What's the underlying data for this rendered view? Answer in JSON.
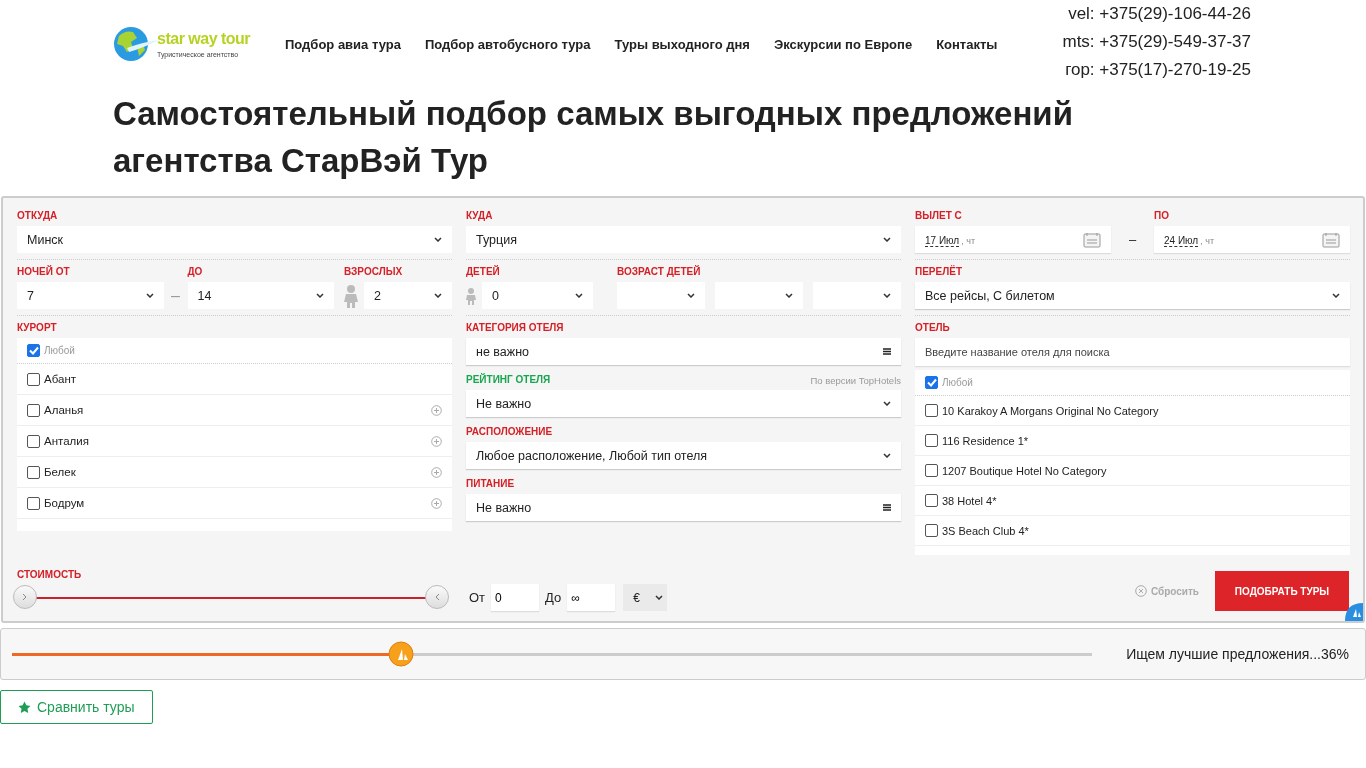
{
  "header": {
    "logo": {
      "name": "star way tour",
      "tagline": "Туристическое агентство"
    },
    "nav": [
      "Подбор авиа тура",
      "Подбор автобусного тура",
      "Туры выходного дня",
      "Экскурсии по Европе",
      "Контакты"
    ],
    "phones": [
      "vel: +375(29)-106-44-26",
      "mts: +375(29)-549-37-37",
      "гор: +375(17)-270-19-25"
    ]
  },
  "heading": "Самостоятельный подбор самых выгодных предложений агентства СтарВэй Тур",
  "search": {
    "from": {
      "label": "ОТКУДА",
      "value": "Минск"
    },
    "to": {
      "label": "КУДА",
      "value": "Турция"
    },
    "departure": {
      "label": "ВЫЛЕТ С",
      "date": "17 Июл",
      "weekday": ", чт"
    },
    "until": {
      "label": "ПО",
      "date": "24 Июл",
      "weekday": ", чт"
    },
    "date_separator": "–",
    "nights_separator": "–",
    "nights_from": {
      "label": "НОЧЕЙ ОТ",
      "value": "7"
    },
    "nights_to": {
      "label": "ДО",
      "value": "14"
    },
    "adults": {
      "label": "ВЗРОСЛЫХ",
      "value": "2"
    },
    "children": {
      "label": "ДЕТЕЙ",
      "value": "0"
    },
    "children_age": {
      "label": "ВОЗРАСТ ДЕТЕЙ",
      "selects": [
        {
          "kind": "select"
        },
        {
          "kind": "select"
        },
        {
          "kind": "select"
        }
      ]
    },
    "flight": {
      "label": "ПЕРЕЛЁТ",
      "value": "Все рейсы, С билетом"
    },
    "resort": {
      "label": "КУРОРТ",
      "items": [
        {
          "label": "Любой",
          "checked": true,
          "expandable": false
        },
        {
          "label": "Абант",
          "checked": false,
          "expandable": false
        },
        {
          "label": "Аланья",
          "checked": false,
          "expandable": true
        },
        {
          "label": "Анталия",
          "checked": false,
          "expandable": true
        },
        {
          "label": "Белек",
          "checked": false,
          "expandable": true
        },
        {
          "label": "Бодрум",
          "checked": false,
          "expandable": true
        }
      ]
    },
    "hotel_category": {
      "label": "КАТЕГОРИЯ ОТЕЛЯ",
      "value": "не важно",
      "kind": "multi"
    },
    "hotel_rating": {
      "label": "РЕЙТИНГ ОТЕЛЯ",
      "note": "По версии TopHotels",
      "value": "Не важно",
      "kind": "select",
      "highlighted": true
    },
    "location": {
      "label": "РАСПОЛОЖЕНИЕ",
      "value": "Любое расположение, Любой тип отеля",
      "kind": "select"
    },
    "meals": {
      "label": "ПИТАНИЕ",
      "value": "Не важно",
      "kind": "multi"
    },
    "hotel": {
      "label": "ОТЕЛЬ",
      "placeholder": "Введите название отеля для поиска",
      "items": [
        {
          "label": "Любой",
          "checked": true
        },
        {
          "label": "10 Karakoy A Morgans Original No Category",
          "checked": false
        },
        {
          "label": "116 Residence 1*",
          "checked": false
        },
        {
          "label": "1207 Boutique Hotel No Category",
          "checked": false
        },
        {
          "label": "38 Hotel 4*",
          "checked": false
        },
        {
          "label": "3S Beach Club 4*",
          "checked": false
        }
      ]
    },
    "price": {
      "label": "СТОИМОСТЬ",
      "thumbs": [
        {
          "level": 0
        },
        {
          "level": 1
        }
      ],
      "from_label": "От",
      "from": "0",
      "to_label": "До",
      "to": "∞",
      "currency": "€"
    },
    "reset": "Сбросить",
    "submit": "ПОДОБРАТЬ ТУРЫ"
  },
  "progress": {
    "level": 0.36,
    "text": "Ищем лучшие предложения...36%"
  },
  "compare": "Сравнить туры"
}
